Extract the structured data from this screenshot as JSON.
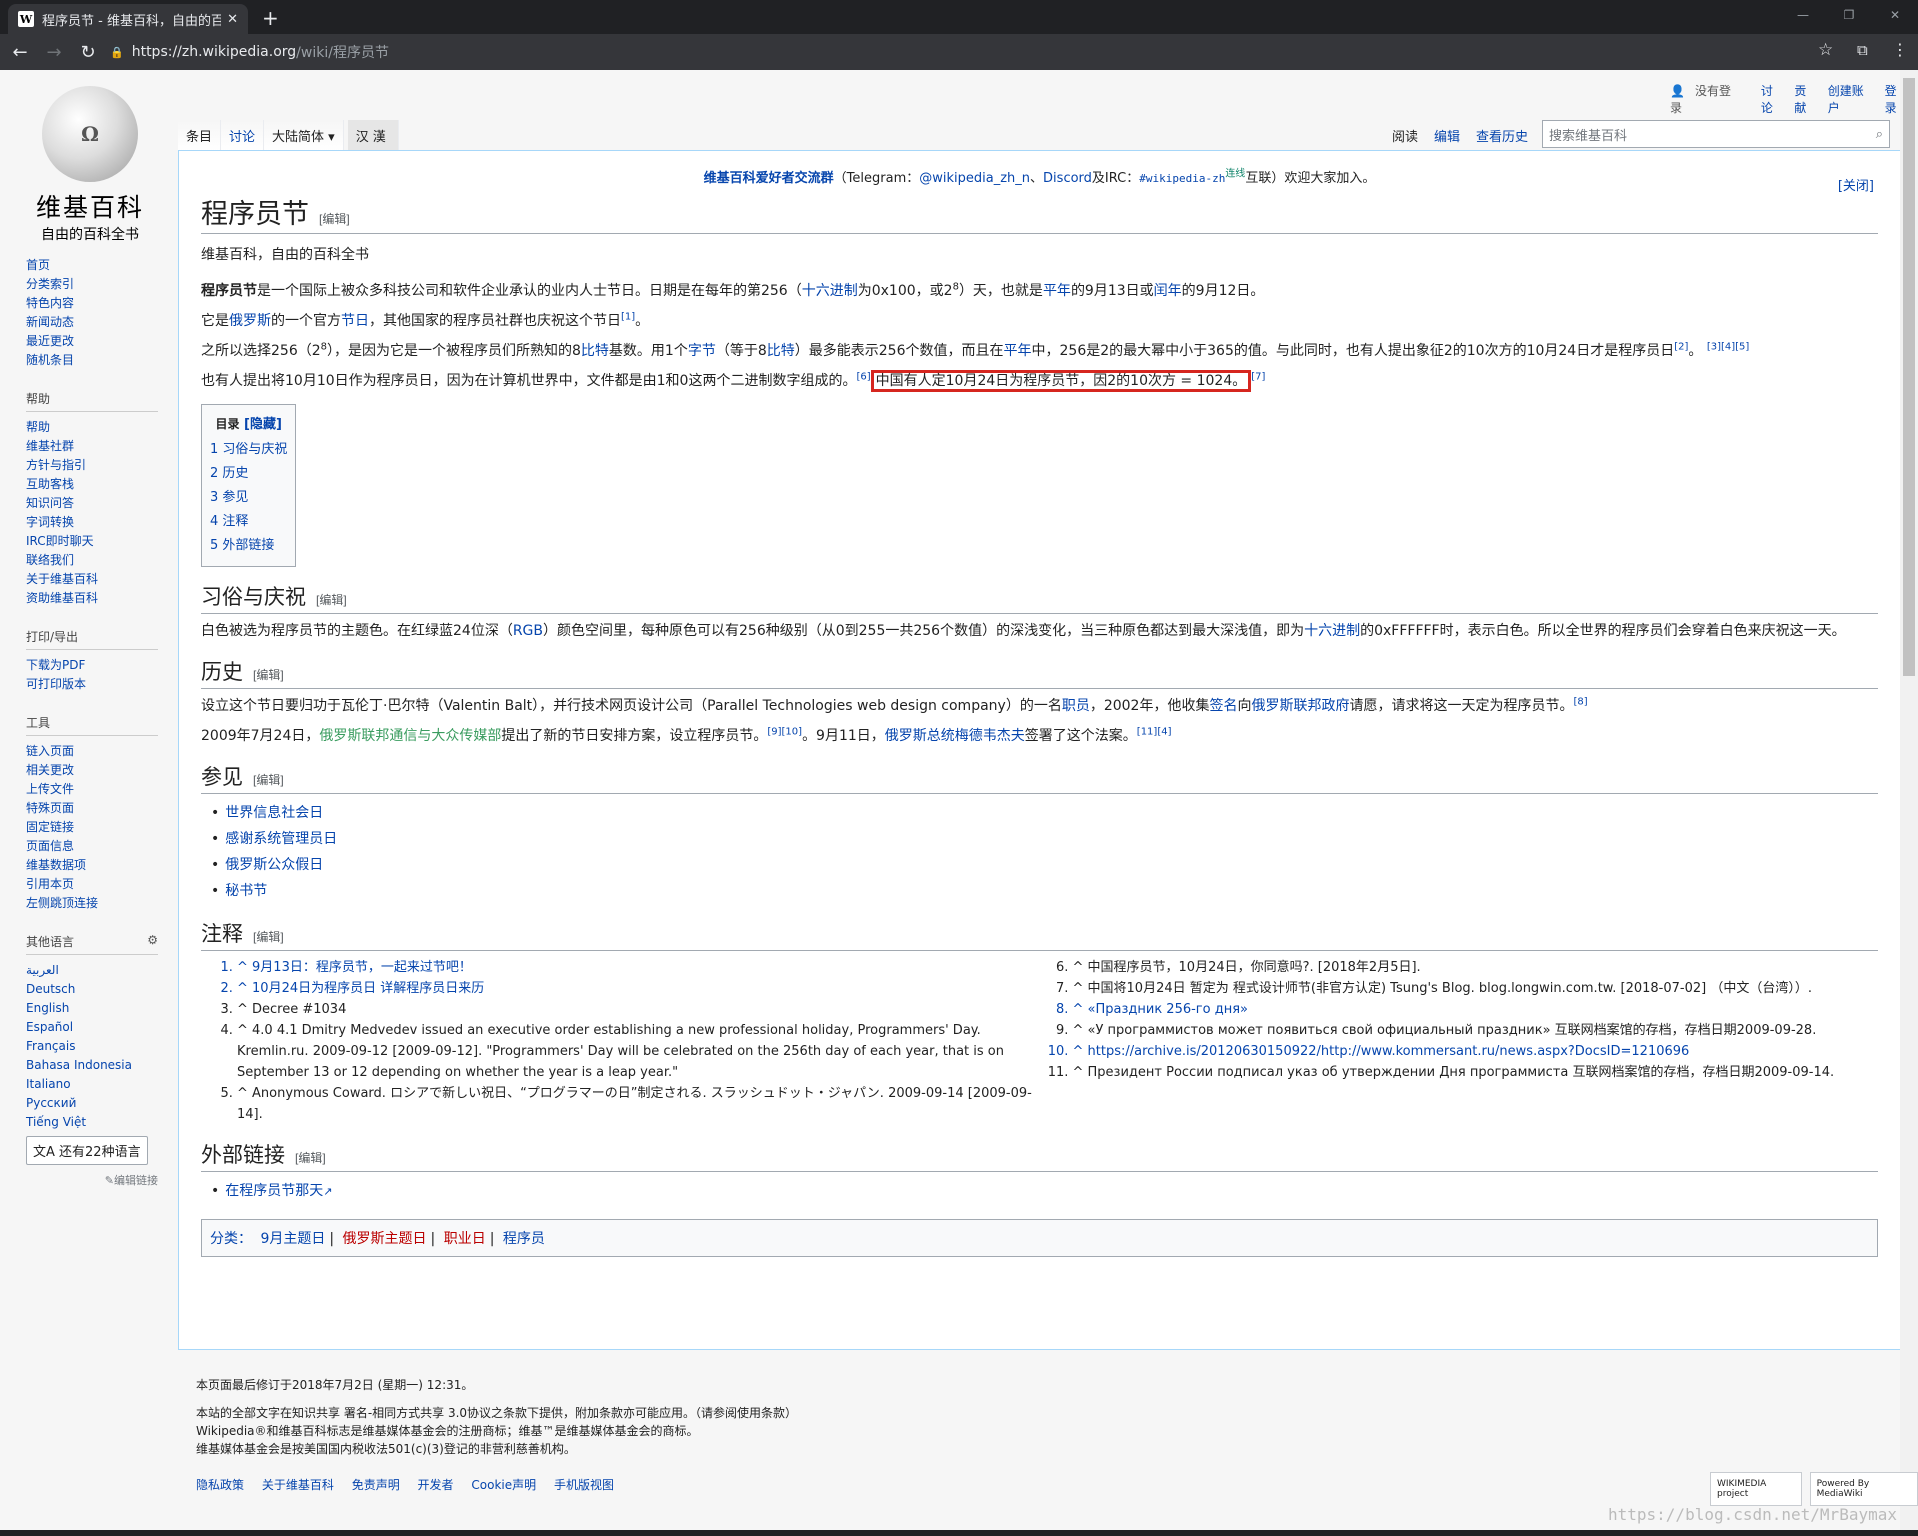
{
  "browser": {
    "tab_title": "程序员节 - 维基百科，自由的百科全书",
    "favicon": "W",
    "url_host": "https://zh.wikipedia.org",
    "url_path": "/wiki/程序员节"
  },
  "logo": {
    "globe": "Ω",
    "wordmark": "维基百科",
    "slogan": "自由的百科全书"
  },
  "personal": {
    "anon": "没有登录",
    "links": [
      "讨论",
      "贡献",
      "创建账户",
      "登录"
    ]
  },
  "tabs": {
    "article": "条目",
    "talk": "讨论",
    "variant": "大陆简体 ▾",
    "han": "汉漢",
    "read": "阅读",
    "edit": "编辑",
    "history": "查看历史"
  },
  "search": {
    "placeholder": "搜索维基百科"
  },
  "sidebar": {
    "nav": [
      "首页",
      "分类索引",
      "特色内容",
      "新闻动态",
      "最近更改",
      "随机条目"
    ],
    "help_title": "帮助",
    "help": [
      "帮助",
      "维基社群",
      "方针与指引",
      "互助客栈",
      "知识问答",
      "字词转换",
      "IRC即时聊天",
      "联络我们",
      "关于维基百科",
      "资助维基百科"
    ],
    "print_title": "打印/导出",
    "print": [
      "下载为PDF",
      "可打印版本"
    ],
    "tools_title": "工具",
    "tools": [
      "链入页面",
      "相关更改",
      "上传文件",
      "特殊页面",
      "固定链接",
      "页面信息",
      "维基数据项",
      "引用本页",
      "左侧跳顶连接"
    ],
    "lang_title": "其他语言",
    "langs": [
      "العربية",
      "Deutsch",
      "English",
      "Español",
      "Français",
      "Bahasa Indonesia",
      "Italiano",
      "Русский",
      "Tiếng Việt"
    ],
    "lang_more": "还有22种语言",
    "lang_edit": "编辑链接"
  },
  "notice": {
    "a": "维基百科爱好者交流群",
    "b": "（Telegram：",
    "c": "@wikipedia_zh_n",
    "d": "、",
    "e": "Discord",
    "f": "及IRC：",
    "g": "#wikipedia-zh",
    "h": "连线",
    "i": "互联）欢迎大家加入。",
    "close": "[关闭]"
  },
  "article": {
    "title": "程序员节",
    "edit": "[编辑]",
    "subtitle": "维基百科，自由的百科全书",
    "p1": {
      "b": "程序员节",
      "t1": "是一个国际上被众多科技公司和软件企业承认的业内人士节日。日期是在每年的第256（",
      "l1": "十六进制",
      "t2": "为0x100，或2",
      "s1": "8",
      "t3": "）天，也就是",
      "l2": "平年",
      "t4": "的9月13日或",
      "l3": "闰年",
      "t5": "的9月12日。"
    },
    "p2": {
      "t1": "它是",
      "l1": "俄罗斯",
      "t2": "的一个官方",
      "l2": "节日",
      "t3": "，其他国家的程序员社群也庆祝这个节日",
      "r1": "[1]",
      "t4": "。"
    },
    "p3": {
      "t1": "之所以选择256（2",
      "s1": "8",
      "t2": "），是因为它是一个被程序员们所熟知的8",
      "l1": "比特",
      "t3": "基数。用1个",
      "l2": "字节",
      "t4": "（等于8",
      "l3": "比特",
      "t5": "）最多能表示256个数值，而且在",
      "l4": "平年",
      "t6": "中，256是2的最大幂中小于365的值。与此同时，也有人提出象征2的10次方的10月24日才是程序员日",
      "r1": "[2]",
      "t7": "。",
      "r2": "[3][4][5]"
    },
    "p4": {
      "t1": "也有人提出将10月10日作为程序员日，因为在计算机世界中，文件都是由1和0这两个二进制数字组成的。",
      "r1": "[6]",
      "hl": "中国有人定10月24日为程序员节，因2的10次方 = 1024。",
      "r2": "[7]"
    },
    "toc": {
      "title": "目录",
      "hide": "[隐藏]",
      "items": [
        "1  习俗与庆祝",
        "2  历史",
        "3  参见",
        "4  注释",
        "5  外部链接"
      ]
    },
    "s1": {
      "title": "习俗与庆祝",
      "t1": "白色被选为程序员节的主题色。在红绿蓝24位深（",
      "l1": "RGB",
      "t2": "）颜色空间里，每种原色可以有256种级别（从0到255一共256个数值）的深浅变化，当三种原色都达到最大深浅值，即为",
      "l2": "十六进制",
      "t3": "的0xFFFFFF时，表示白色。所以全世界的程序员们会穿着白色来庆祝这一天。"
    },
    "s2": {
      "title": "历史",
      "t1": "设立这个节日要归功于瓦伦丁·巴尔特（Valentin Balt），并行技术网页设计公司（Parallel Technologies web design company）的一名",
      "l1": "职员",
      "t2": "，2002年，他收集",
      "l2": "签名",
      "t3": "向",
      "l3": "俄罗斯联邦政府",
      "t4": "请愿，请求将这一天定为程序员节。",
      "r1": "[8]",
      "t5": "2009年7月24日，",
      "l4": "俄罗斯联邦通信与大众传媒部",
      "t6": "提出了新的节日安排方案，设立程序员节。",
      "r2": "[9][10]",
      "t7": "。9月11日，",
      "l5": "俄罗斯总统梅德韦杰夫",
      "t8": "签署了这个法案。",
      "r3": "[11][4]"
    },
    "s3": {
      "title": "参见",
      "items": [
        "世界信息社会日",
        "感谢系统管理员日",
        "俄罗斯公众假日",
        "秘书节"
      ]
    },
    "s4": {
      "title": "注释",
      "left": [
        "^ 9月13日：程序员节，一起来过节吧！",
        "^ 10月24日为程序员日 详解程序员日来历",
        "^ Decree #1034",
        "^ 4.0 4.1 Dmitry Medvedev issued an executive order establishing a new professional holiday, Programmers' Day. Kremlin.ru. 2009-09-12 [2009-09-12]. \"Programmers' Day will be celebrated on the 256th day of each year, that is on September 13 or 12 depending on whether the year is a leap year.\"",
        "^ Anonymous Coward. ロシアで新しい祝日、“プログラマーの日”制定される. スラッシュドット・ジャパン. 2009-09-14 [2009-09-14]."
      ],
      "right": [
        "^ 中国程序员节，10月24日，你同意吗?. [2018年2月5日].",
        "^ 中国将10月24日 暂定为 程式设计师节(非官方认定)   Tsung's Blog. blog.longwin.com.tw. [2018-07-02] （中文（台湾））.",
        "^ «Праздник 256-го дня»",
        "^ «У программистов может появиться свой официальный праздник» 互联网档案馆的存档，存档日期2009-09-28.",
        "^ https://archive.is/20120630150922/http://www.kommersant.ru/news.aspx?DocsID=1210696",
        "^ Президент России подписал указ об утверждении Дня программиста 互联网档案馆的存档，存档日期2009-09-14."
      ]
    },
    "s5": {
      "title": "外部链接",
      "items": [
        "在程序员节那天"
      ]
    },
    "cats": {
      "label": "分类：",
      "items": [
        "9月主题日",
        "俄罗斯主题日",
        "职业日",
        "程序员"
      ]
    }
  },
  "footer": {
    "modified": "本页面最后修订于2018年7月2日 (星期一) 12:31。",
    "l1": "本站的全部文字在知识共享 署名-相同方式共享 3.0协议之条款下提供，附加条款亦可能应用。（请参阅使用条款）",
    "l2": "Wikipedia®和维基百科标志是维基媒体基金会的注册商标；维基™是维基媒体基金会的商标。",
    "l3": "维基媒体基金会是按美国国内税收法501(c)(3)登记的非营利慈善机构。",
    "links": [
      "隐私政策",
      "关于维基百科",
      "免责声明",
      "开发者",
      "Cookie声明",
      "手机版视图"
    ],
    "badge1": "WIKIMEDIA project",
    "badge2": "Powered By MediaWiki"
  },
  "watermark": "https://blog.csdn.net/MrBaymax"
}
